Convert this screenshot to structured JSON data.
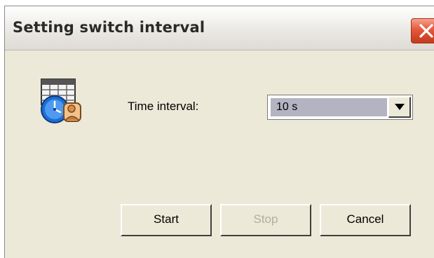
{
  "window": {
    "title": "Setting switch interval"
  },
  "icons": {
    "app": "clock-calendar-user-icon",
    "close": "close-icon",
    "dropdown": "chevron-down-icon"
  },
  "form": {
    "interval_label": "Time interval:",
    "interval_value": "10 s"
  },
  "buttons": {
    "start": "Start",
    "stop": "Stop",
    "cancel": "Cancel"
  },
  "colors": {
    "window_bg": "#ece9d8",
    "close_button": "#e2593c",
    "selection_bg": "#b3b3c2",
    "disabled_text": "#b0aea5"
  }
}
